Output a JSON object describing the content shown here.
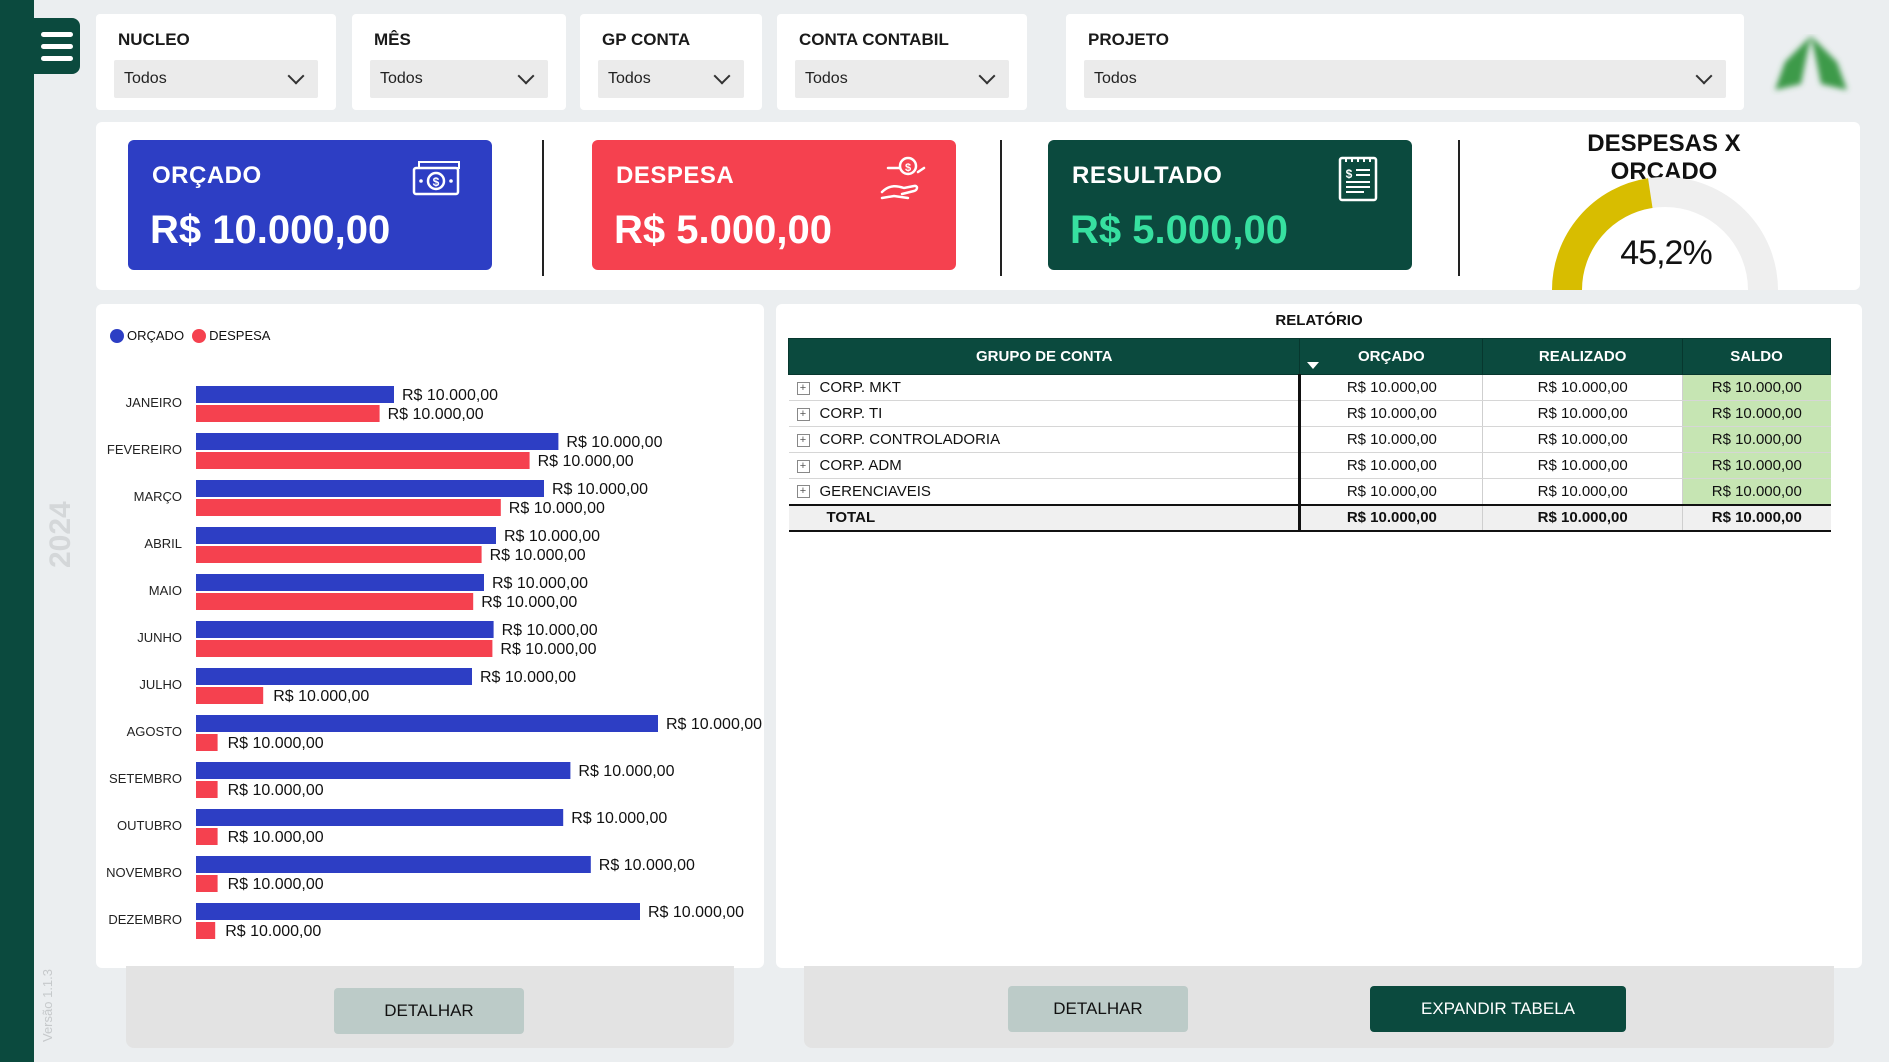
{
  "filters": [
    {
      "label": "NUCLEO",
      "value": "Todos"
    },
    {
      "label": "MÊS",
      "value": "Todos"
    },
    {
      "label": "GP CONTA",
      "value": "Todos"
    },
    {
      "label": "CONTA CONTABIL",
      "value": "Todos"
    },
    {
      "label": "PROJETO",
      "value": "Todos"
    }
  ],
  "sidebar": {
    "year": "2024",
    "version": "Versão 1.1.3"
  },
  "kpis": {
    "orcado": {
      "label": "ORÇADO",
      "value": "R$ 10.000,00",
      "color": "#2d3ec4",
      "icon": "money-bill-icon"
    },
    "despesa": {
      "label": "DESPESA",
      "value": "R$ 5.000,00",
      "color": "#f5414f",
      "icon": "hand-coin-icon"
    },
    "resultado": {
      "label": "RESULTADO",
      "value": "R$ 5.000,00",
      "color": "#0b4a3e",
      "value_color": "#37e0a0",
      "icon": "invoice-icon"
    }
  },
  "gauge": {
    "title": "DESPESAS X ORÇADO",
    "value_label": "45,2%",
    "value": 0.452,
    "fill_color": "#d8bd00",
    "track_color": "#efefef"
  },
  "chart_data": {
    "type": "bar",
    "orientation": "horizontal",
    "categories": [
      "JANEIRO",
      "FEVEREIRO",
      "MARÇO",
      "ABRIL",
      "MAIO",
      "JUNHO",
      "JULHO",
      "AGOSTO",
      "SETEMBRO",
      "OUTUBRO",
      "NOVEMBRO",
      "DEZEMBRO"
    ],
    "series": [
      {
        "name": "ORÇADO",
        "color": "#2d3ec4",
        "values": [
          165,
          302,
          290,
          250,
          240,
          248,
          230,
          385,
          312,
          306,
          329,
          370
        ],
        "labels": [
          "R$ 10.000,00",
          "R$ 10.000,00",
          "R$ 10.000,00",
          "R$ 10.000,00",
          "R$ 10.000,00",
          "R$ 10.000,00",
          "R$ 10.000,00",
          "R$ 10.000,00",
          "R$ 10.000,00",
          "R$ 10.000,00",
          "R$ 10.000,00",
          "R$ 10.000,00"
        ]
      },
      {
        "name": "DESPESA",
        "color": "#f5414f",
        "values": [
          153,
          278,
          254,
          238,
          231,
          247,
          56,
          18,
          18,
          18,
          18,
          16
        ],
        "labels": [
          "R$ 10.000,00",
          "R$ 10.000,00",
          "R$ 10.000,00",
          "R$ 10.000,00",
          "R$ 10.000,00",
          "R$ 10.000,00",
          "R$ 10.000,00",
          "R$ 10.000,00",
          "R$ 10.000,00",
          "R$ 10.000,00",
          "R$ 10.000,00",
          "R$ 10.000,00"
        ]
      }
    ],
    "legend_position": "top-left",
    "grid": false
  },
  "report": {
    "title": "RELATÓRIO",
    "columns": [
      "GRUPO DE CONTA",
      "ORÇADO",
      "REALIZADO",
      "SALDO"
    ],
    "rows": [
      {
        "group": "CORP. MKT",
        "orcado": "R$ 10.000,00",
        "realizado": "R$ 10.000,00",
        "saldo": "R$ 10.000,00"
      },
      {
        "group": "CORP. TI",
        "orcado": "R$ 10.000,00",
        "realizado": "R$ 10.000,00",
        "saldo": "R$ 10.000,00"
      },
      {
        "group": "CORP. CONTROLADORIA",
        "orcado": "R$ 10.000,00",
        "realizado": "R$ 10.000,00",
        "saldo": "R$ 10.000,00"
      },
      {
        "group": "CORP. ADM",
        "orcado": "R$ 10.000,00",
        "realizado": "R$ 10.000,00",
        "saldo": "R$ 10.000,00"
      },
      {
        "group": "GERENCIAVEIS",
        "orcado": "R$ 10.000,00",
        "realizado": "R$ 10.000,00",
        "saldo": "R$ 10.000,00"
      }
    ],
    "total": {
      "group": "TOTAL",
      "orcado": "R$ 10.000,00",
      "realizado": "R$ 10.000,00",
      "saldo": "R$ 10.000,00"
    },
    "expand_symbol": "+"
  },
  "buttons": {
    "detalhar_chart": "DETALHAR",
    "detalhar_table": "DETALHAR",
    "expandir": "EXPANDIR TABELA"
  }
}
